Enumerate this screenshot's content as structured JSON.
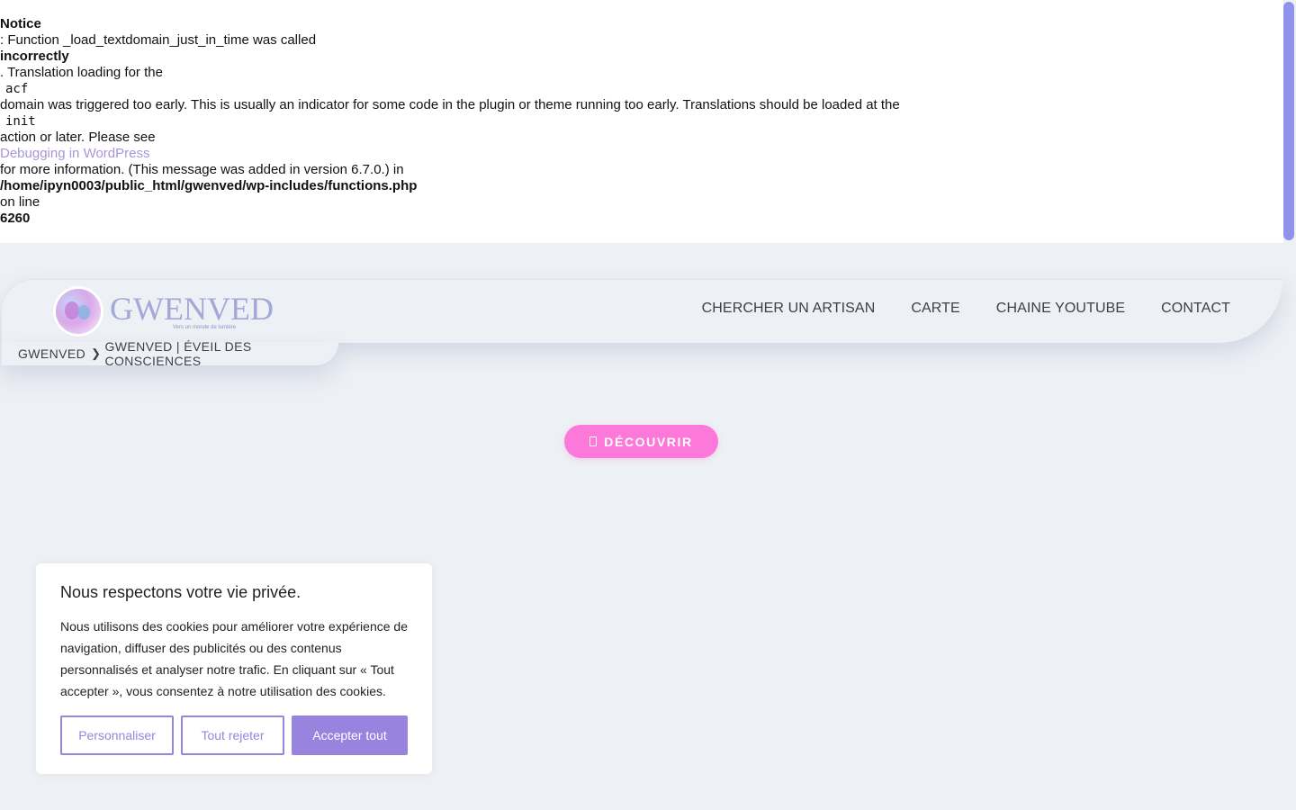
{
  "notice": {
    "lines": [
      "Notice",
      ": Function _load_textdomain_just_in_time was called",
      "incorrectly",
      ". Translation loading for the",
      "acf",
      "domain was triggered too early. This is usually an indicator for some code in the plugin or theme running too early. Translations should be loaded at the",
      "init",
      "action or later. Please see",
      "Debugging in WordPress",
      "for more information. (This message was added in version 6.7.0.) in",
      "/home/ipyn0003/public_html/gwenved/wp-includes/functions.php",
      "on line",
      "6260"
    ]
  },
  "header": {
    "logo_text": "GWENVED",
    "logo_tagline": "Vers un monde de lumière",
    "nav": [
      "CHERCHER UN ARTISAN",
      "CARTE",
      "CHAINE YOUTUBE",
      "CONTACT"
    ]
  },
  "breadcrumb": {
    "home": "GWENVED",
    "separator": "❯",
    "current": "GWENVED | ÉVEIL DES CONSCIENCES"
  },
  "main": {
    "discover_button": "DÉCOUVRIR"
  },
  "cookie": {
    "title": "Nous respectons votre vie privée.",
    "text": "Nous utilisons des cookies pour améliorer votre expérience de navigation, diffuser des publicités ou des contenus personnalisés et analyser notre trafic. En cliquant sur « Tout accepter », vous consentez à notre utilisation des cookies.",
    "customize": "Personnaliser",
    "reject": "Tout rejeter",
    "accept": "Accepter tout"
  },
  "colors": {
    "accent_purple": "#9883df",
    "button_pink": "#fc78d9",
    "logo_blue": "#a3a8d6",
    "link": "#a894dc"
  }
}
